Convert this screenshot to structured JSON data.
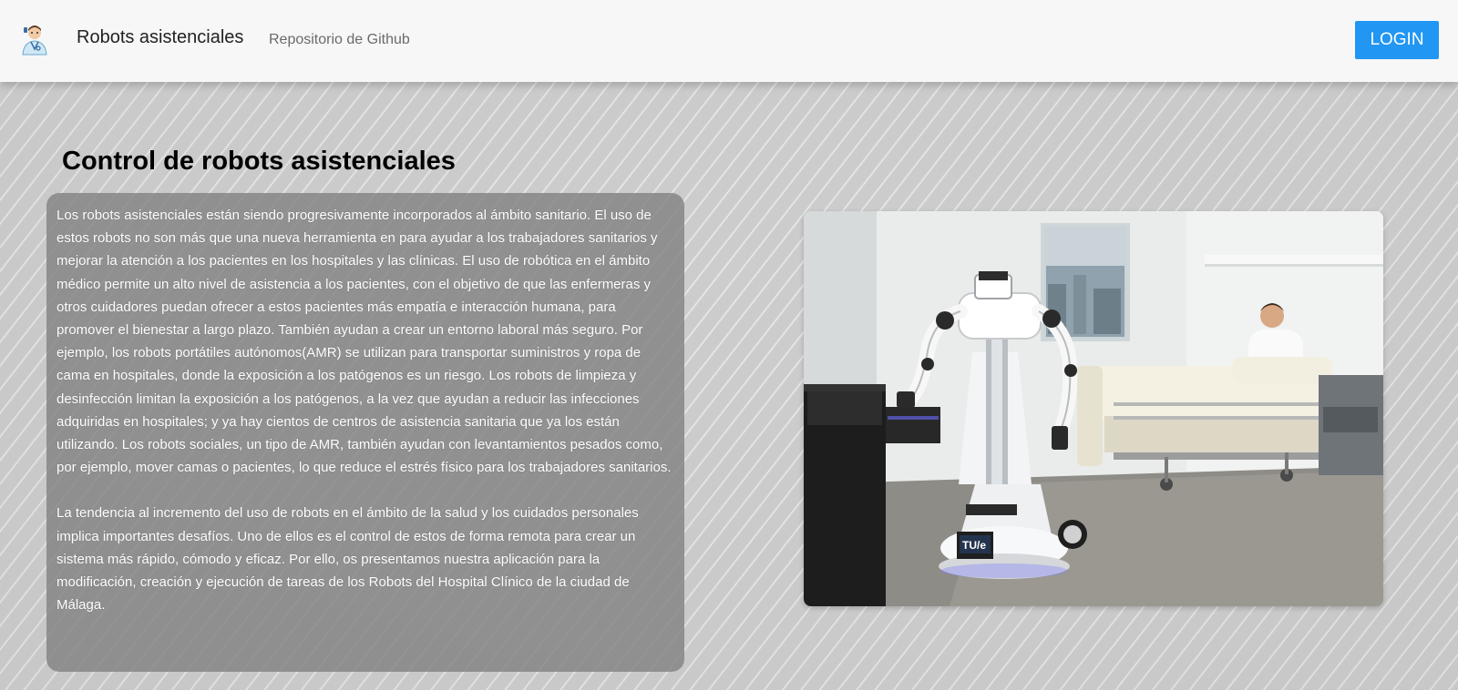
{
  "navbar": {
    "brand": "Robots asistenciales",
    "link": "Repositorio de Github",
    "login_label": "LOGIN"
  },
  "main": {
    "title": "Control de robots asistenciales",
    "paragraphs": [
      "Los robots asistenciales están siendo progresivamente incorporados al ámbito sanitario. El uso de estos robots no son más que una nueva herramienta en para ayudar a los trabajadores sanitarios y mejorar la atención a los pacientes en los hospitales y las clínicas. El uso de robótica en el ámbito médico permite un alto nivel de asistencia a los pacientes, con el objetivo de que las enfermeras y otros cuidadores puedan ofrecer a estos pacientes más empatía e interacción humana, para promover el bienestar a largo plazo. También ayudan a crear un entorno laboral más seguro. Por ejemplo, los robots portátiles autónomos(AMR) se utilizan para transportar suministros y ropa de cama en hospitales, donde la exposición a los patógenos es un riesgo. Los robots de limpieza y desinfección limitan la exposición a los patógenos, a la vez que ayudan a reducir las infecciones adquiridas en hospitales; y ya hay cientos de centros de asistencia sanitaria que ya los están utilizando. Los robots sociales, un tipo de AMR, también ayudan con levantamientos pesados como, por ejemplo, mover camas o pacientes, lo que reduce el estrés físico para los trabajadores sanitarios.",
      "La tendencia al incremento del uso de robots en el ámbito de la salud y los cuidados personales implica importantes desafíos. Uno de ellos es el control de estos de forma remota para crear un sistema más rápido, cómodo y eficaz. Por ello, os presentamos nuestra aplicación para la modificación, creación y ejecución de tareas de los Robots del Hospital Clínico de la ciudad de Málaga."
    ],
    "robot_badge": "TU/e"
  },
  "colors": {
    "login_button": "#2196f3",
    "navbar_bg": "#f7f7f7",
    "panel_bg": "#828282"
  }
}
